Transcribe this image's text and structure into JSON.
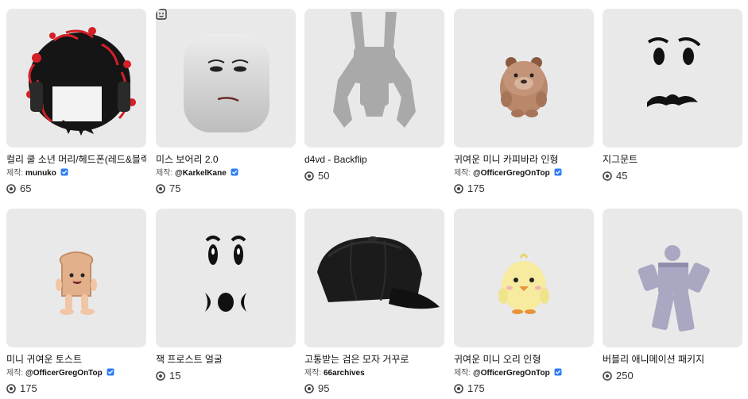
{
  "items": [
    {
      "name": "컬리 쿨 소년 머리/헤드폰(레드&블랙)",
      "by": "제작:",
      "creator": "munuko",
      "verified": true,
      "price": "65",
      "thumb": "hair-thumbnail"
    },
    {
      "name": "미스 보어리 2.0",
      "by": "제작:",
      "creator": "@KarkelKane",
      "verified": true,
      "price": "75",
      "thumb": "bored-face-head-thumbnail",
      "badge": "dynamic-head-icon"
    },
    {
      "name": "d4vd - Backflip",
      "by": "",
      "creator": "",
      "verified": false,
      "price": "50",
      "thumb": "backflip-animation-thumbnail"
    },
    {
      "name": "귀여운 미니 카피바라 인형",
      "by": "제작:",
      "creator": "@OfficerGregOnTop",
      "verified": true,
      "price": "175",
      "thumb": "capybara-plush-thumbnail"
    },
    {
      "name": "지그문트",
      "by": "",
      "creator": "",
      "verified": false,
      "price": "45",
      "thumb": "mustache-face-thumbnail"
    },
    {
      "name": "미니 귀여운 토스트",
      "by": "제작:",
      "creator": "@OfficerGregOnTop",
      "verified": true,
      "price": "175",
      "thumb": "toast-plush-thumbnail"
    },
    {
      "name": "잭 프로스트 얼굴",
      "by": "",
      "creator": "",
      "verified": false,
      "price": "15",
      "thumb": "jack-frost-face-thumbnail"
    },
    {
      "name": "고통받는 검은 모자 거꾸로",
      "by": "제작:",
      "creator": "66archives",
      "verified": false,
      "price": "95",
      "thumb": "black-cap-thumbnail"
    },
    {
      "name": "귀여운 미니 오리 인형",
      "by": "제작:",
      "creator": "@OfficerGregOnTop",
      "verified": true,
      "price": "175",
      "thumb": "duck-plush-thumbnail"
    },
    {
      "name": "버블리 애니메이션 패키지",
      "by": "",
      "creator": "",
      "verified": false,
      "price": "250",
      "thumb": "bubbly-animation-thumbnail"
    }
  ],
  "colors": {
    "thumb_bg": "#e9e9ea",
    "verified": "#2f7df6",
    "hair_red": "#d41f26"
  }
}
